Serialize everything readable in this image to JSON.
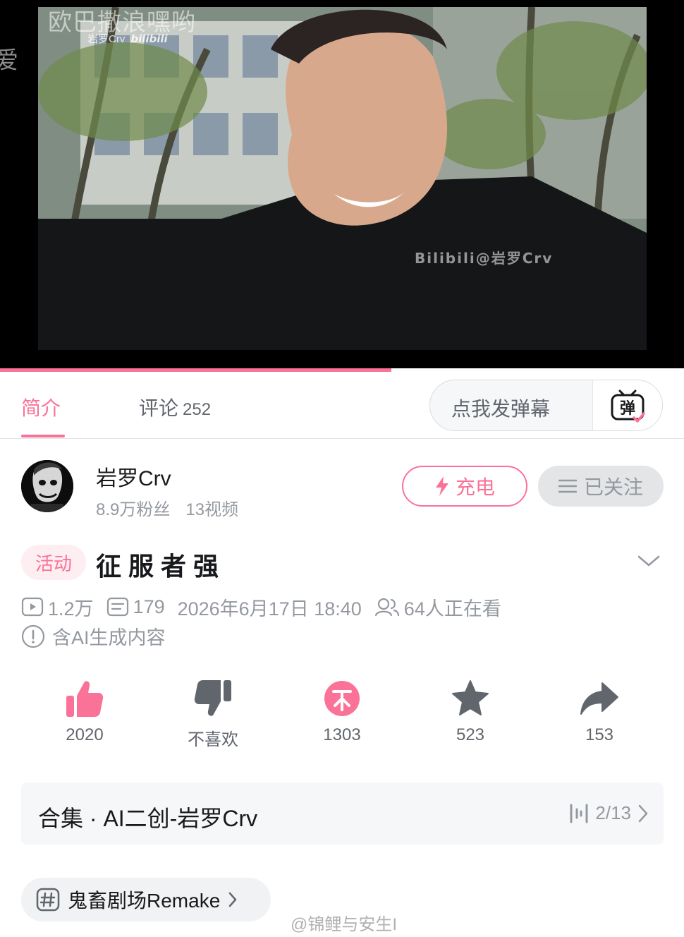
{
  "video": {
    "overlay_text": "欧巴撒浪嘿哟",
    "edge_char": "爱",
    "watermark_small": "岩罗Crv",
    "watermark_small_logo": "bilibili",
    "watermark_center": "Bilibili@岩罗Crv",
    "progress_fraction": 0.572
  },
  "tabs": {
    "intro_label": "简介",
    "comments_label": "评论",
    "comments_count": "252",
    "danmaku_placeholder": "点我发弹幕",
    "danmaku_icon_char": "弹"
  },
  "uploader": {
    "name": "岩罗Crv",
    "fans": "8.9万粉丝",
    "videos": "13视频",
    "charge_label": "充电",
    "follow_label": "已关注"
  },
  "title": {
    "badge": "活动",
    "text": "征服者强"
  },
  "stats": {
    "plays": "1.2万",
    "danmaku_count": "179",
    "datetime": "2026年6月17日 18:40",
    "watching": "64人正在看",
    "ai_notice": "含AI生成内容"
  },
  "actions": {
    "like": "2020",
    "dislike": "不喜欢",
    "coin": "1303",
    "favorite": "523",
    "share": "153"
  },
  "collection": {
    "title": "合集 · AI二创-岩罗Crv",
    "progress": "2/13"
  },
  "tag": {
    "label": "鬼畜剧场Remake"
  },
  "source_watermark": "@锦鲤与安生I",
  "colors": {
    "accent": "#fb7299",
    "text_primary": "#18191c",
    "text_secondary": "#9499a0",
    "icon_gray": "#61666d"
  }
}
